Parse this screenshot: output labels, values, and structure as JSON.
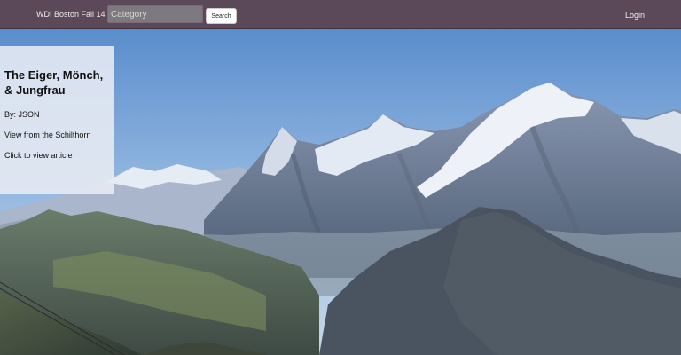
{
  "navbar": {
    "brand": "WDI Boston Fall 14",
    "search": {
      "placeholder": "Category",
      "value": "",
      "button_label": "Search"
    },
    "login": "Login"
  },
  "article": {
    "title": "The Eiger, Mönch, & Jungfrau",
    "author": "By: JSON",
    "subtitle": "View from the Schilthorn",
    "cta": "Click to view article"
  },
  "colors": {
    "navbar": "#5b4858",
    "sky": "#5f8fc9",
    "panel": "#e8ecf4"
  }
}
